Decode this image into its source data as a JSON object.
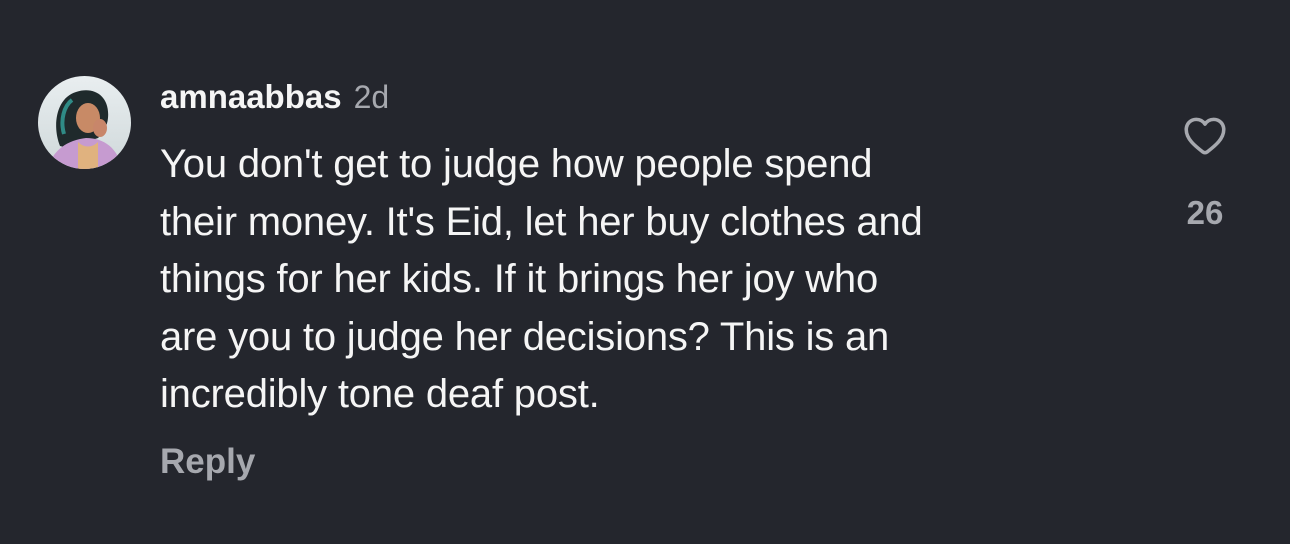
{
  "comment": {
    "avatar_icon": "user-avatar",
    "username": "amnaabbas",
    "time_ago": "2d",
    "text": "You don't get to judge how people spend\ntheir money. It's Eid, let her buy clothes and\nthings for her kids. If it brings her joy who\nare you to judge her decisions? This is an\nincredibly tone deaf post.",
    "reply_label": "Reply",
    "like_icon": "heart-icon",
    "like_count": "26"
  },
  "colors": {
    "background": "#24262d",
    "primary_text": "#f5f5f5",
    "secondary_text": "#a6a8ae"
  }
}
